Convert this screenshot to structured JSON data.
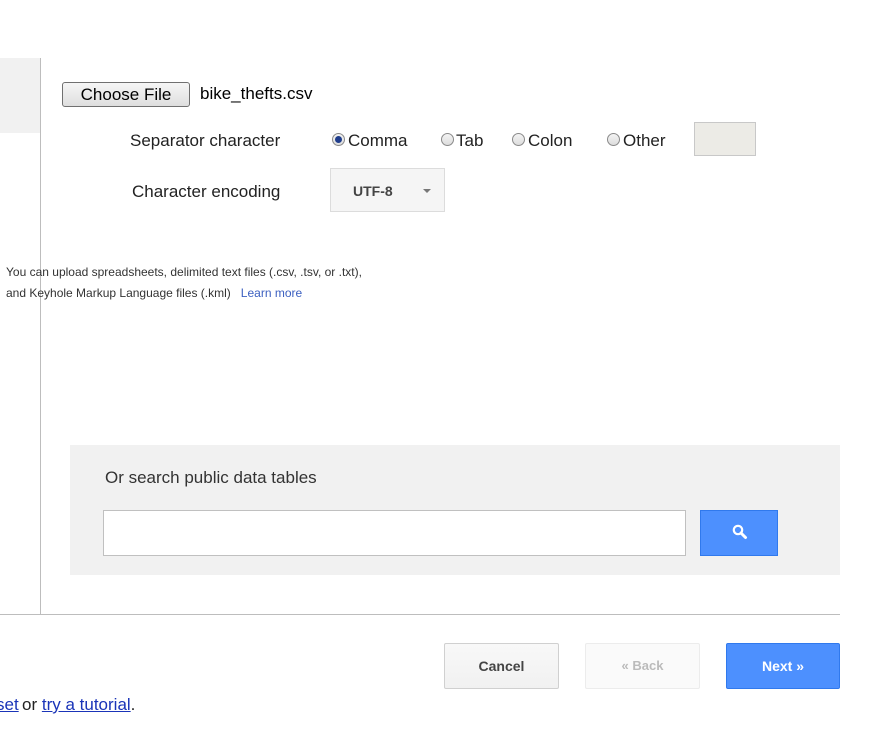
{
  "upload": {
    "choose_file_label": "Choose File",
    "file_name": "bike_thefts.csv"
  },
  "separator": {
    "label": "Separator character",
    "options": [
      "Comma",
      "Tab",
      "Colon",
      "Other"
    ],
    "selected": "Comma",
    "other_value": ""
  },
  "encoding": {
    "label": "Character encoding",
    "value": "UTF-8"
  },
  "help": {
    "line1": "You can upload spreadsheets, delimited text files (.csv, .tsv, or .txt),",
    "line2": "and Keyhole Markup Language files (.kml)",
    "learn_more": "Learn more"
  },
  "search": {
    "title": "Or search public data tables",
    "query": "",
    "icon": "search-icon",
    "button_color": "#4d90fe"
  },
  "actions": {
    "cancel": "Cancel",
    "back": "« Back",
    "next": "Next »"
  },
  "footer": {
    "link1_partial": "set",
    "middle": "or",
    "link2": "try a tutorial",
    "end": "."
  }
}
